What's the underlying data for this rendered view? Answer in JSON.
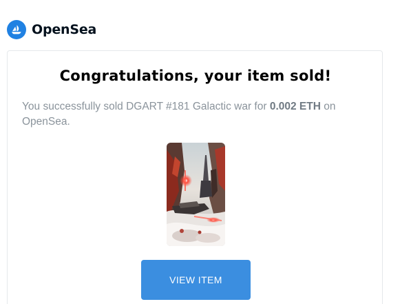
{
  "brand": {
    "name": "OpenSea",
    "logo_icon": "opensea-logo-icon",
    "color": "#2081e2"
  },
  "email": {
    "headline": "Congratulations, your item sold!",
    "message": {
      "prefix": "You successfully sold DGART #181 Galactic war for ",
      "price": "0.002 ETH",
      "suffix": " on OpenSea."
    },
    "item_image_icon": "nft-artwork-image",
    "button": {
      "label": "VIEW ITEM",
      "color": "#3b8ee0"
    }
  }
}
